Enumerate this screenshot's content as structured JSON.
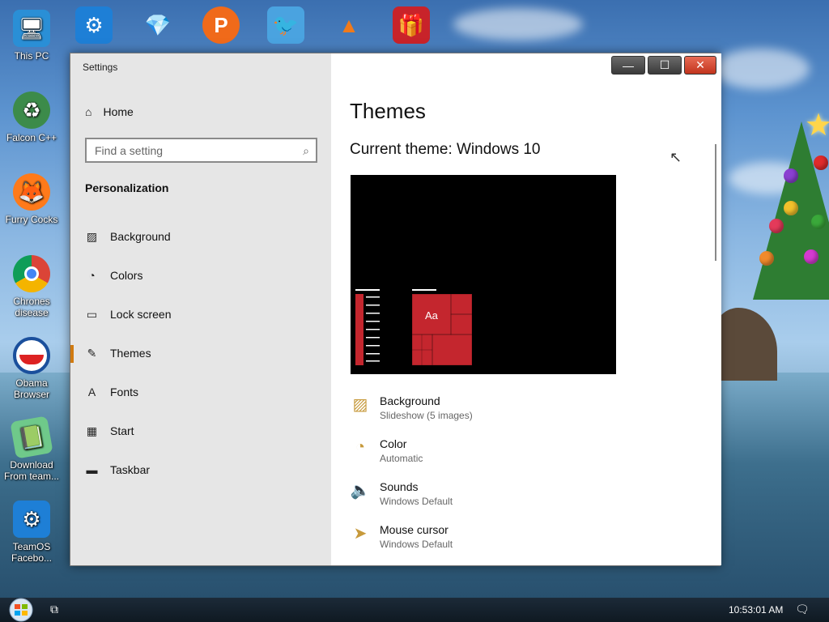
{
  "desktop": {
    "left_icons": [
      {
        "label": "This PC",
        "icon": "monitor-icon"
      },
      {
        "label": "Falcon C++",
        "icon": "recycle-icon"
      },
      {
        "label": "Furry Cocks",
        "icon": "firefox-icon"
      },
      {
        "label": "Chrones disease",
        "icon": "chrome-icon"
      },
      {
        "label": "Obama Browser",
        "icon": "obama-logo-icon"
      },
      {
        "label": "Download From team...",
        "icon": "notebook-icon"
      },
      {
        "label": "TeamOS Facebo...",
        "icon": "gear-icon"
      }
    ],
    "top_icons": [
      "gear-icon",
      "diamond-icon",
      "p-logo-icon",
      "angry-bird-icon",
      "vlc-icon",
      "gift-icon"
    ]
  },
  "window": {
    "title": "Settings",
    "min_symbol": "—",
    "max_symbol": "☐",
    "close_symbol": "✕"
  },
  "sidebar": {
    "home_label": "Home",
    "search_placeholder": "Find a setting",
    "section_title": "Personalization",
    "items": [
      {
        "label": "Background",
        "icon": "image-icon",
        "glyph": "🖼"
      },
      {
        "label": "Colors",
        "icon": "palette-icon",
        "glyph": "🎨"
      },
      {
        "label": "Lock screen",
        "icon": "lock-screen-icon",
        "glyph": "▭"
      },
      {
        "label": "Themes",
        "icon": "themes-icon",
        "glyph": "✎"
      },
      {
        "label": "Fonts",
        "icon": "fonts-icon",
        "glyph": "A"
      },
      {
        "label": "Start",
        "icon": "start-icon",
        "glyph": "▦"
      },
      {
        "label": "Taskbar",
        "icon": "taskbar-icon",
        "glyph": "▬"
      }
    ],
    "active_index": 3
  },
  "main": {
    "title": "Themes",
    "current_theme": "Current theme: Windows 10",
    "preview_tile_text": "Aa",
    "accent_color": "#c4262e",
    "options": [
      {
        "label": "Background",
        "sub": "Slideshow (5 images)",
        "icon": "image-icon"
      },
      {
        "label": "Color",
        "sub": "Automatic",
        "icon": "palette-icon"
      },
      {
        "label": "Sounds",
        "sub": "Windows Default",
        "icon": "speaker-icon"
      },
      {
        "label": "Mouse cursor",
        "sub": "Windows Default",
        "icon": "cursor-icon"
      }
    ]
  },
  "taskbar": {
    "clock": "10:53:01 AM"
  }
}
